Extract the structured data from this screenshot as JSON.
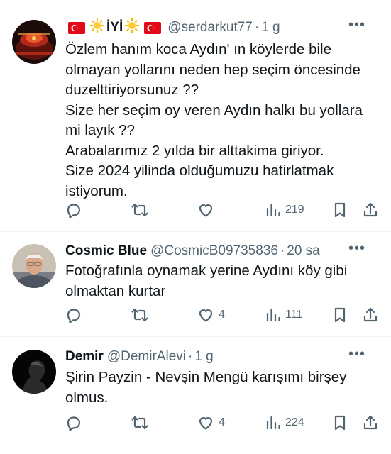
{
  "tweets": [
    {
      "display_name": "İYİ",
      "handle": "@serdarkut77",
      "separator": "·",
      "time": "1 g",
      "text": "Özlem hanım koca Aydın' ın köylerde bile\nolmayan yollarını neden hep seçim öncesinde\nduzelttiriyorsunuz ??\nSize her seçim oy veren Aydın halkı bu yollara\nmi layık ??\nArabalarımız 2 yılda bir alttakima giriyor.\nSize 2024 yilinda olduğumuzu hatirlatmak\nistiyorum.",
      "replies": "",
      "retweets": "",
      "likes": "",
      "views": "219"
    },
    {
      "display_name": "Cosmic Blue",
      "handle": "@CosmicB09735836",
      "separator": "·",
      "time": "20 sa",
      "text": "Fotoğrafınla oynamak yerine Aydını köy gibi\nolmaktan kurtar",
      "replies": "",
      "retweets": "",
      "likes": "4",
      "views": "111"
    },
    {
      "display_name": "Demir",
      "handle": "@DemirAlevi",
      "separator": "·",
      "time": "1 g",
      "text": "Şirin Payzin -  Nevşin Mengü karışımı birşey\nolmus.",
      "replies": "",
      "retweets": "",
      "likes": "4",
      "views": "224"
    }
  ],
  "more_label": "•••",
  "colors": {
    "text": "#0f1419",
    "secondary": "#536471",
    "divider": "#eff3f4",
    "flag_red": "#e30a17"
  },
  "icons": [
    "reply-icon",
    "retweet-icon",
    "like-icon",
    "views-icon",
    "bookmark-icon",
    "share-icon",
    "more-icon"
  ]
}
